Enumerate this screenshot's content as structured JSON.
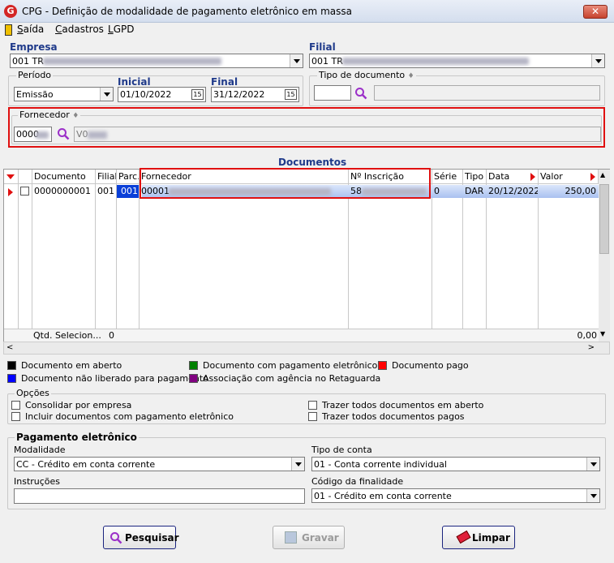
{
  "window": {
    "title": "CPG - Definição de modalidade de pagamento eletrônico em massa",
    "close_label": "✕"
  },
  "menu": {
    "items": [
      {
        "first": "S",
        "rest": "aída"
      },
      {
        "first": "C",
        "rest": "adastros"
      },
      {
        "first": "L",
        "rest": "GPD"
      }
    ]
  },
  "empresa": {
    "label": "Empresa",
    "value": "001 TR"
  },
  "filial": {
    "label": "Filial",
    "value": "001 TR"
  },
  "periodo": {
    "label": "Período",
    "value": "Emissão",
    "inicial_label": "Inicial",
    "inicial": "01/10/2022",
    "final_label": "Final",
    "final": "31/12/2022",
    "cal_icon": "15"
  },
  "tipo_documento": {
    "label": "Tipo de documento",
    "code": "",
    "description": ""
  },
  "fornecedor": {
    "label": "Fornecedor",
    "code": "0000",
    "description": "V0"
  },
  "documentos": {
    "title": "Documentos",
    "columns": [
      "Documento",
      "Filial",
      "Parc.",
      "Fornecedor",
      "Nº Inscrição",
      "Série",
      "Tipo",
      "Data",
      "Valor"
    ],
    "rows": [
      {
        "documento": "0000000001",
        "filial": "001",
        "parc": "001",
        "fornecedor": "00001",
        "inscricao": "58",
        "serie": "0",
        "tipo": "DAR",
        "data": "20/12/2022",
        "valor": "250,00"
      }
    ],
    "footer": {
      "qtd_label": "Qtd. Selecion...",
      "qtd_value": "0",
      "total": "0,00"
    }
  },
  "legend": [
    {
      "label": "Documento em aberto",
      "color": "#000000"
    },
    {
      "label": "Documento com pagamento eletrônico",
      "color": "#008000"
    },
    {
      "label": "Documento pago",
      "color": "#ff0000"
    },
    {
      "label": "Documento não liberado para pagamento",
      "color": "#0000ff"
    },
    {
      "label": "Associação com agência no Retaguarda",
      "color": "#800080"
    }
  ],
  "opcoes": {
    "title": "Opções",
    "items": [
      "Consolidar por empresa",
      "Incluir documentos com pagamento eletrônico",
      "Trazer todos documentos em aberto",
      "Trazer todos documentos pagos"
    ]
  },
  "pagamento": {
    "title": "Pagamento eletrônico",
    "modalidade_label": "Modalidade",
    "modalidade": "CC  - Crédito em conta corrente",
    "tipo_conta_label": "Tipo de conta",
    "tipo_conta": "01 - Conta corrente individual",
    "instrucoes_label": "Instruções",
    "instrucoes": "",
    "finalidade_label": "Código da finalidade",
    "finalidade": "01 - Crédito em conta corrente"
  },
  "buttons": {
    "pesquisar": "Pesquisar",
    "gravar": "Gravar",
    "limpar": "Limpar"
  },
  "colors": {
    "selection": "#a9c1f0",
    "highlight_box": "#e01010",
    "section_title": "#1f3a8a"
  }
}
